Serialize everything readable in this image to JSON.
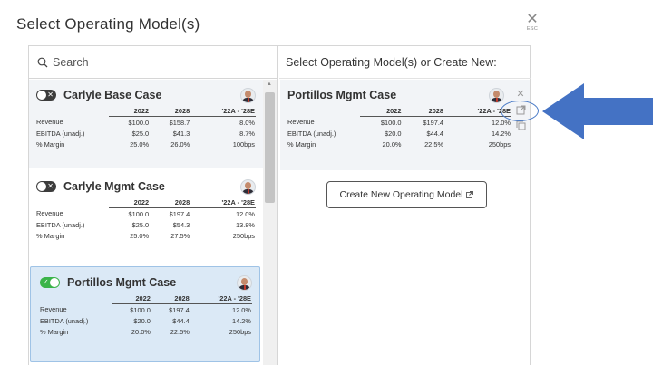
{
  "dialog": {
    "title": "Select Operating Model(s)",
    "close_label": "ESC"
  },
  "search": {
    "placeholder": "Search"
  },
  "right_panel": {
    "heading": "Select Operating Model(s) or Create New:",
    "create_button": "Create New Operating Model"
  },
  "table_headers": [
    "2022",
    "2028",
    "'22A - '28E"
  ],
  "models": [
    {
      "name": "Carlyle Base Case",
      "enabled": false,
      "rows": [
        {
          "label": "Revenue",
          "v1": "$100.0",
          "v2": "$158.7",
          "v3": "8.0%"
        },
        {
          "label": "EBITDA (unadj.)",
          "v1": "$25.0",
          "v2": "$41.3",
          "v3": "8.7%"
        },
        {
          "label": "% Margin",
          "v1": "25.0%",
          "v2": "26.0%",
          "v3": "100bps"
        }
      ]
    },
    {
      "name": "Carlyle Mgmt Case",
      "enabled": false,
      "rows": [
        {
          "label": "Revenue",
          "v1": "$100.0",
          "v2": "$197.4",
          "v3": "12.0%"
        },
        {
          "label": "EBITDA (unadj.)",
          "v1": "$25.0",
          "v2": "$54.3",
          "v3": "13.8%"
        },
        {
          "label": "% Margin",
          "v1": "25.0%",
          "v2": "27.5%",
          "v3": "250bps"
        }
      ]
    },
    {
      "name": "Portillos Mgmt Case",
      "enabled": true,
      "rows": [
        {
          "label": "Revenue",
          "v1": "$100.0",
          "v2": "$197.4",
          "v3": "12.0%"
        },
        {
          "label": "EBITDA (unadj.)",
          "v1": "$20.0",
          "v2": "$44.4",
          "v3": "14.2%"
        },
        {
          "label": "% Margin",
          "v1": "20.0%",
          "v2": "22.5%",
          "v3": "250bps"
        }
      ]
    }
  ],
  "selected_model": {
    "name": "Portillos Mgmt Case",
    "rows": [
      {
        "label": "Revenue",
        "v1": "$100.0",
        "v2": "$197.4",
        "v3": "12.0%"
      },
      {
        "label": "EBITDA (unadj.)",
        "v1": "$20.0",
        "v2": "$44.4",
        "v3": "14.2%"
      },
      {
        "label": "% Margin",
        "v1": "20.0%",
        "v2": "22.5%",
        "v3": "250bps"
      }
    ]
  },
  "colors": {
    "toggle_on": "#3bb44a",
    "toggle_off": "#3c3c3c",
    "selected_card_bg": "#dbe9f6",
    "arrow": "#4472c4"
  },
  "icons": [
    "search-icon",
    "close-icon",
    "avatar",
    "remove-icon",
    "open-external-icon",
    "copy-icon",
    "arrow-annotation"
  ]
}
